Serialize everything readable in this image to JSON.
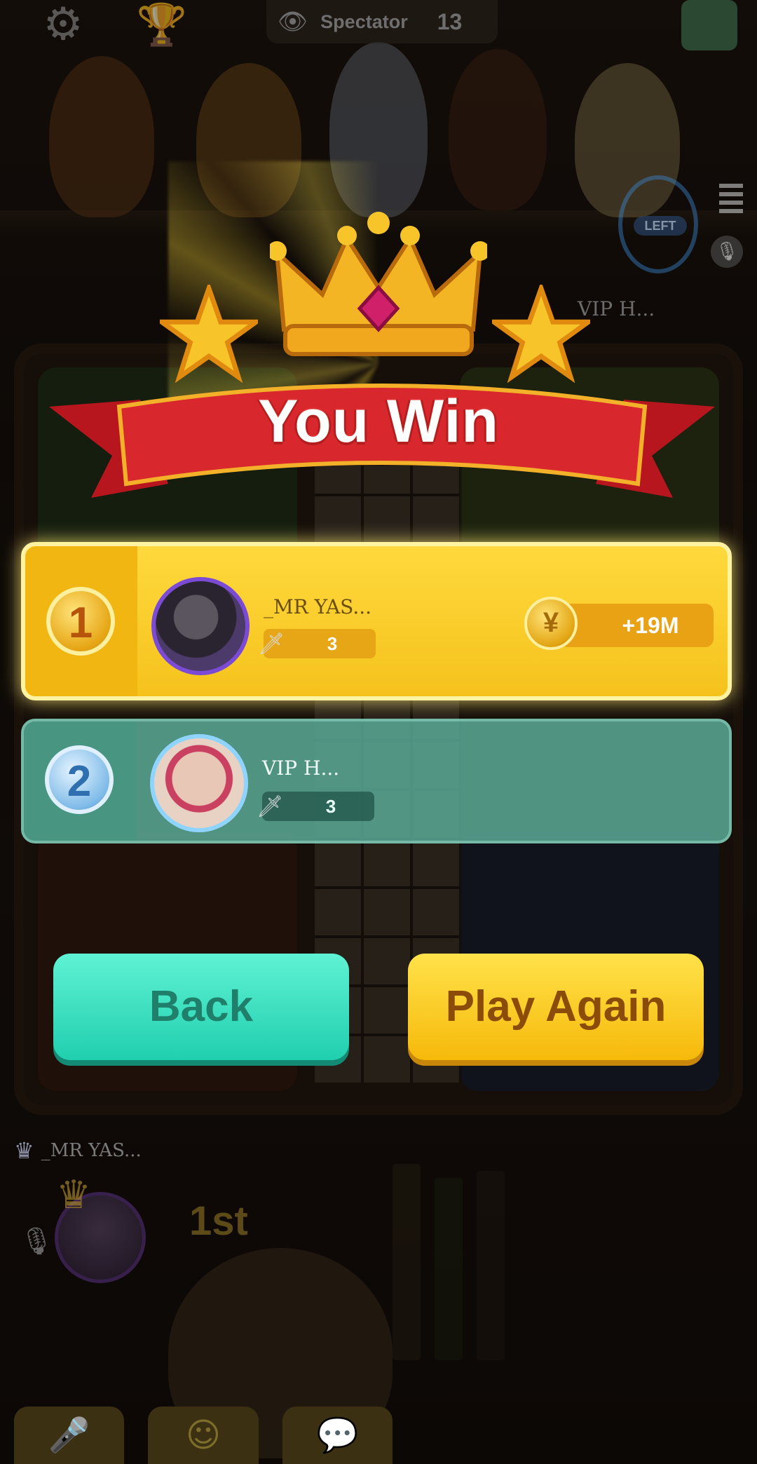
{
  "top_bar": {
    "spectator_label": "Spectator",
    "spectator_count": "13",
    "icons": [
      "gear-icon",
      "trophy-icon",
      "eye-icon",
      "shop-bag-icon",
      "menu-icon",
      "mic-icon"
    ]
  },
  "status": {
    "left_label": "LEFT",
    "opponent_tag": "VIP H..."
  },
  "result": {
    "title": "You Win",
    "players": [
      {
        "rank": "1",
        "name": "_MR YAS...",
        "score": "3",
        "reward": "+19M"
      },
      {
        "rank": "2",
        "name": "VIP H...",
        "score": "3"
      }
    ]
  },
  "actions": {
    "back_label": "Back",
    "play_again_label": "Play Again"
  },
  "local_player": {
    "name": "_MR YAS...",
    "place": "1st"
  },
  "bottom_bar": {
    "icons": [
      "microphone-icon",
      "emoji-icon",
      "chat-icon"
    ]
  },
  "colors": {
    "win_row": "#f5c21c",
    "second_row": "#5caa96",
    "back_button": "#20cfae",
    "play_again_button": "#f6b90a",
    "banner_red": "#d9272e"
  }
}
